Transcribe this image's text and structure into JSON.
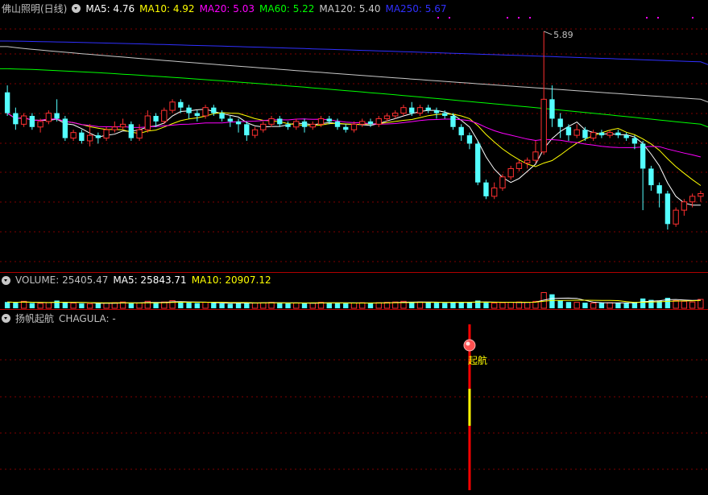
{
  "price_header": {
    "title": "佛山照明(日线)",
    "ma5": "MA5: 4.76",
    "ma10": "MA10: 4.92",
    "ma20": "MA20: 5.03",
    "ma60": "MA60: 5.22",
    "ma120": "MA120: 5.40",
    "ma250": "MA250: 5.67"
  },
  "volume_header": {
    "volume": "VOLUME: 25405.47",
    "ma5": "MA5: 25843.71",
    "ma10": "MA10: 20907.12"
  },
  "indicator_header": {
    "title": "扬帆起航",
    "chagula": "CHAGULA: -"
  },
  "annotations": {
    "high_label": "5.89",
    "signal_label": "起航"
  },
  "colors": {
    "up": "#ff3030",
    "down": "#54ffff",
    "ma5": "#ffffff",
    "ma10": "#ffff00",
    "ma20": "#ff00ff",
    "ma60": "#00ff00",
    "ma120": "#c8c8c8",
    "ma250": "#3030ff",
    "grid": "#800000"
  },
  "chart_data": {
    "type": "candlestick",
    "stock": "佛山照明",
    "period": "日线",
    "price_range": [
      4.2,
      6.0
    ],
    "candles": [
      [
        5.45,
        5.3,
        5.5,
        5.28
      ],
      [
        5.3,
        5.22,
        5.34,
        5.18
      ],
      [
        5.22,
        5.28,
        5.3,
        5.2
      ],
      [
        5.28,
        5.2,
        5.3,
        5.18
      ],
      [
        5.2,
        5.24,
        5.26,
        5.16
      ],
      [
        5.24,
        5.3,
        5.32,
        5.22
      ],
      [
        5.3,
        5.26,
        5.4,
        5.24
      ],
      [
        5.26,
        5.12,
        5.28,
        5.1
      ],
      [
        5.12,
        5.16,
        5.18,
        5.1
      ],
      [
        5.16,
        5.1,
        5.18,
        5.08
      ],
      [
        5.1,
        5.14,
        5.22,
        5.06
      ],
      [
        5.14,
        5.12,
        5.16,
        5.08
      ],
      [
        5.12,
        5.18,
        5.2,
        5.1
      ],
      [
        5.18,
        5.2,
        5.24,
        5.16
      ],
      [
        5.2,
        5.22,
        5.26,
        5.18
      ],
      [
        5.22,
        5.12,
        5.24,
        5.1
      ],
      [
        5.12,
        5.18,
        5.22,
        5.1
      ],
      [
        5.18,
        5.28,
        5.32,
        5.16
      ],
      [
        5.28,
        5.24,
        5.3,
        5.2
      ],
      [
        5.24,
        5.32,
        5.34,
        5.22
      ],
      [
        5.32,
        5.38,
        5.4,
        5.3
      ],
      [
        5.38,
        5.34,
        5.4,
        5.3
      ],
      [
        5.34,
        5.3,
        5.36,
        5.26
      ],
      [
        5.3,
        5.28,
        5.32,
        5.24
      ],
      [
        5.28,
        5.34,
        5.36,
        5.26
      ],
      [
        5.34,
        5.3,
        5.36,
        5.28
      ],
      [
        5.3,
        5.26,
        5.32,
        5.24
      ],
      [
        5.26,
        5.24,
        5.28,
        5.2
      ],
      [
        5.24,
        5.22,
        5.26,
        5.16
      ],
      [
        5.22,
        5.14,
        5.24,
        5.1
      ],
      [
        5.14,
        5.18,
        5.2,
        5.12
      ],
      [
        5.18,
        5.22,
        5.24,
        5.16
      ],
      [
        5.22,
        5.26,
        5.28,
        5.2
      ],
      [
        5.26,
        5.22,
        5.28,
        5.2
      ],
      [
        5.22,
        5.2,
        5.24,
        5.18
      ],
      [
        5.2,
        5.24,
        5.26,
        5.18
      ],
      [
        5.24,
        5.2,
        5.26,
        5.16
      ],
      [
        5.2,
        5.22,
        5.24,
        5.18
      ],
      [
        5.22,
        5.26,
        5.28,
        5.2
      ],
      [
        5.26,
        5.24,
        5.28,
        5.22
      ],
      [
        5.24,
        5.2,
        5.26,
        5.18
      ],
      [
        5.2,
        5.18,
        5.22,
        5.16
      ],
      [
        5.18,
        5.22,
        5.24,
        5.16
      ],
      [
        5.22,
        5.24,
        5.26,
        5.2
      ],
      [
        5.24,
        5.22,
        5.26,
        5.2
      ],
      [
        5.22,
        5.26,
        5.28,
        5.2
      ],
      [
        5.26,
        5.28,
        5.3,
        5.24
      ],
      [
        5.28,
        5.3,
        5.32,
        5.26
      ],
      [
        5.3,
        5.34,
        5.36,
        5.28
      ],
      [
        5.34,
        5.3,
        5.38,
        5.28
      ],
      [
        5.3,
        5.34,
        5.36,
        5.28
      ],
      [
        5.34,
        5.32,
        5.36,
        5.3
      ],
      [
        5.32,
        5.3,
        5.34,
        5.26
      ],
      [
        5.3,
        5.28,
        5.32,
        5.26
      ],
      [
        5.28,
        5.2,
        5.3,
        5.18
      ],
      [
        5.2,
        5.14,
        5.22,
        5.1
      ],
      [
        5.14,
        5.08,
        5.16,
        5.04
      ],
      [
        5.08,
        4.8,
        5.1,
        4.78
      ],
      [
        4.8,
        4.7,
        4.82,
        4.68
      ],
      [
        4.7,
        4.76,
        4.8,
        4.68
      ],
      [
        4.76,
        4.84,
        4.86,
        4.74
      ],
      [
        4.84,
        4.9,
        4.92,
        4.82
      ],
      [
        4.9,
        4.94,
        4.96,
        4.88
      ],
      [
        4.94,
        4.96,
        4.98,
        4.9
      ],
      [
        4.96,
        5.02,
        5.1,
        4.94
      ],
      [
        5.02,
        5.4,
        5.89,
        5.0
      ],
      [
        5.4,
        5.26,
        5.5,
        5.2
      ],
      [
        5.26,
        5.2,
        5.3,
        5.12
      ],
      [
        5.2,
        5.14,
        5.22,
        5.1
      ],
      [
        5.14,
        5.18,
        5.22,
        5.12
      ],
      [
        5.18,
        5.12,
        5.2,
        5.1
      ],
      [
        5.12,
        5.16,
        5.18,
        5.1
      ],
      [
        5.16,
        5.14,
        5.18,
        5.12
      ],
      [
        5.14,
        5.16,
        5.18,
        5.12
      ],
      [
        5.16,
        5.14,
        5.18,
        5.12
      ],
      [
        5.14,
        5.12,
        5.16,
        5.1
      ],
      [
        5.12,
        5.08,
        5.14,
        5.04
      ],
      [
        5.08,
        4.9,
        5.1,
        4.6
      ],
      [
        4.9,
        4.78,
        4.92,
        4.74
      ],
      [
        4.78,
        4.72,
        4.8,
        4.62
      ],
      [
        4.72,
        4.5,
        4.74,
        4.46
      ],
      [
        4.5,
        4.6,
        4.62,
        4.48
      ],
      [
        4.6,
        4.66,
        4.68,
        4.56
      ],
      [
        4.66,
        4.7,
        4.72,
        4.62
      ],
      [
        4.7,
        4.72,
        4.74,
        4.66
      ]
    ],
    "ma_series_end": {
      "MA5": 4.76,
      "MA10": 4.92,
      "MA20": 5.03,
      "MA60": 5.22,
      "MA120": 5.4,
      "MA250": 5.67
    },
    "volume_range": [
      0,
      60000
    ],
    "volumes": [
      18000,
      16000,
      20000,
      15000,
      14000,
      16000,
      22000,
      17000,
      15000,
      14000,
      13000,
      14000,
      15000,
      16000,
      18000,
      14000,
      15000,
      20000,
      17000,
      18000,
      22000,
      18000,
      16000,
      15000,
      17000,
      15000,
      14000,
      13000,
      16000,
      17000,
      15000,
      16000,
      17000,
      15000,
      14000,
      15000,
      14000,
      15000,
      17000,
      16000,
      15000,
      14000,
      15000,
      16000,
      15000,
      16000,
      17000,
      18000,
      20000,
      17000,
      18000,
      17000,
      16000,
      15000,
      18000,
      17000,
      18000,
      22000,
      16000,
      15000,
      16000,
      17000,
      18000,
      17000,
      20000,
      45000,
      40000,
      22000,
      18000,
      17000,
      16000,
      15000,
      15000,
      16000,
      15000,
      16000,
      18000,
      28000,
      24000,
      22000,
      30000,
      22000,
      20000,
      18000,
      25405
    ],
    "signal_index": 56
  }
}
